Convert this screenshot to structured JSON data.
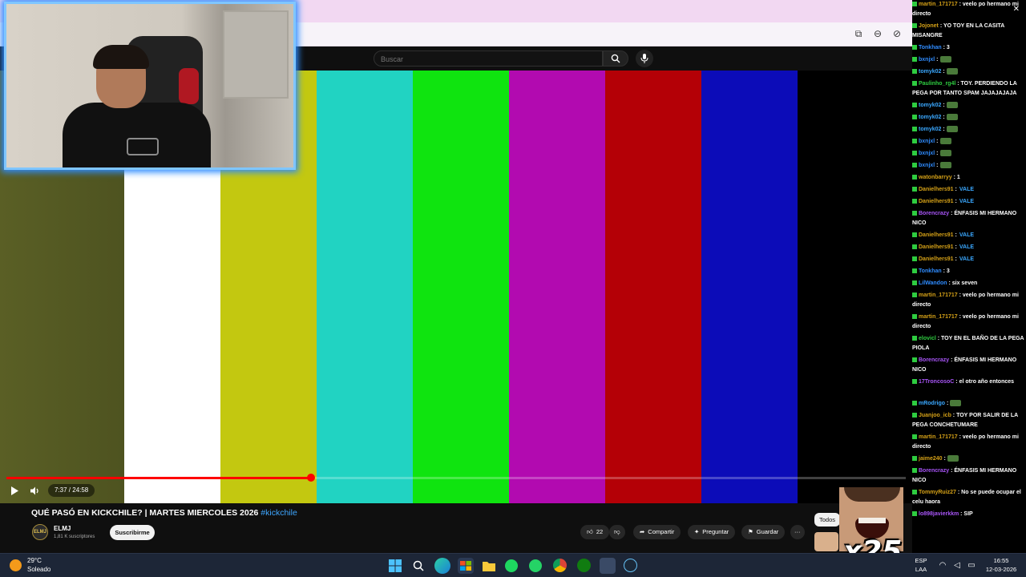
{
  "search": {
    "placeholder": "Buscar"
  },
  "player": {
    "time": "7:37 / 24:58",
    "progress_fraction": 0.339,
    "buffer_fraction": 0.38
  },
  "color_bars": [
    "#565b23",
    "#ffffff",
    "#c3c810",
    "#21d3c2",
    "#0fe40f",
    "#b20ab0",
    "#b40006",
    "#0c0cb8",
    "#000000"
  ],
  "video": {
    "title": "QUÉ PASÓ EN KICKCHILE? | MARTES MIERCOLES 2026",
    "hashtag": "#kickchile"
  },
  "channel": {
    "avatar_text": "ELMJ",
    "name": "ELMJ",
    "subscribers": "1,81 K suscriptores",
    "subscribe_label": "Suscribirme"
  },
  "actions": {
    "likes": "22",
    "share": "Compartir",
    "ask": "Preguntar",
    "save": "Guardar"
  },
  "right": {
    "todos": "Todos",
    "emote_text": "x25"
  },
  "chat": [
    {
      "user": "martin_171717",
      "color": "#d4a017",
      "text": ": veelo po hermano mi directo"
    },
    {
      "user": "Jojonet",
      "color": "#d4a017",
      "text": ": YO TOY EN LA CASITA MISANGRE"
    },
    {
      "user": "Tonkhan",
      "color": "#2f8cff",
      "text": ": 3"
    },
    {
      "user": "bxnjxl",
      "color": "#2f8cff",
      "text": ":"
    },
    {
      "user": "tomyk02",
      "color": "#3aa8ff",
      "text": ":"
    },
    {
      "user": "Paulinho_rg4l",
      "color": "#2ecc40",
      "text": ": TOY. PERDIENDO LA PEGA POR TANTO SPAM JAJAJAJAJA"
    },
    {
      "user": "tomyk02",
      "color": "#3aa8ff",
      "text": ":"
    },
    {
      "user": "tomyk02",
      "color": "#3aa8ff",
      "text": ":"
    },
    {
      "user": "tomyk02",
      "color": "#3aa8ff",
      "text": ":"
    },
    {
      "user": "bxnjxl",
      "color": "#2f8cff",
      "text": ":"
    },
    {
      "user": "bxnjxl",
      "color": "#2f8cff",
      "text": ":"
    },
    {
      "user": "bxnjxl",
      "color": "#2f8cff",
      "text": ":"
    },
    {
      "user": "watonbarryy",
      "color": "#d4a017",
      "text": ": 1"
    },
    {
      "user": "Danielhers91",
      "color": "#d4a017",
      "text": ":",
      "vale": "VALE"
    },
    {
      "user": "Danielhers91",
      "color": "#d4a017",
      "text": ":",
      "vale": "VALE"
    },
    {
      "user": "Borencrazy",
      "color": "#a855f7",
      "text": ": ÉNFASIS MI HERMANO NICO"
    },
    {
      "user": "Danielhers91",
      "color": "#d4a017",
      "text": ":",
      "vale": "VALE"
    },
    {
      "user": "Danielhers91",
      "color": "#d4a017",
      "text": ":",
      "vale": "VALE"
    },
    {
      "user": "Danielhers91",
      "color": "#d4a017",
      "text": ":",
      "vale": "VALE"
    },
    {
      "user": "Tonkhan",
      "color": "#2f8cff",
      "text": ": 3"
    },
    {
      "user": "LilWandon",
      "color": "#2f8cff",
      "text": ": six seven"
    },
    {
      "user": "martin_171717",
      "color": "#d4a017",
      "text": ": veelo po hermano mi directo"
    },
    {
      "user": "martin_171717",
      "color": "#d4a017",
      "text": ": veelo po hermano mi directo"
    },
    {
      "user": "elovicl",
      "color": "#2ecc40",
      "text": ": TOY EN EL BAÑO DE LA PEGA PIOLA"
    },
    {
      "user": "Borencrazy",
      "color": "#a855f7",
      "text": ": ÉNFASIS MI HERMANO NICO"
    },
    {
      "user": "17TroncosoC",
      "color": "#a855f7",
      "text": ": el otro año entonces"
    },
    {
      "user": "mRodrigo",
      "color": "#3aa8ff",
      "text": ":"
    },
    {
      "user": "Juanjoo_icb",
      "color": "#d4a017",
      "text": ": TOY POR SALIR DE LA PEGA CONCHETUMARE"
    },
    {
      "user": "martin_171717",
      "color": "#d4a017",
      "text": ": veelo po hermano mi directo"
    },
    {
      "user": "jaime240",
      "color": "#d4a017",
      "text": ":"
    },
    {
      "user": "Borencrazy",
      "color": "#a855f7",
      "text": ": ÉNFASIS MI HERMANO NICO"
    },
    {
      "user": "TommyRuiz27",
      "color": "#d4a017",
      "text": ": No se puede ocupar el celu haora"
    },
    {
      "user": "lo898javierkkm",
      "color": "#a855f7",
      "text": ": SIP"
    }
  ],
  "taskbar": {
    "temperature": "29°C",
    "weather": "Soleado",
    "lang_top": "ESP",
    "lang_bottom": "LAA",
    "clock_time": "16:55",
    "clock_date": "12-03-2026"
  },
  "icons": [
    "copy-link-icon",
    "zoom-icon",
    "eye-off-icon",
    "menu-icon",
    "search-icon",
    "mic-icon",
    "play-icon",
    "volume-icon",
    "like-icon",
    "dislike-icon",
    "share-icon",
    "sparkle-icon",
    "bookmark-icon",
    "more-icon",
    "start-icon",
    "edge-icon",
    "store-icon",
    "folder-icon",
    "spotify-icon",
    "whatsapp-icon",
    "chrome-icon",
    "xbox-icon",
    "steam-icon",
    "wifi-icon",
    "volume-tray-icon"
  ]
}
